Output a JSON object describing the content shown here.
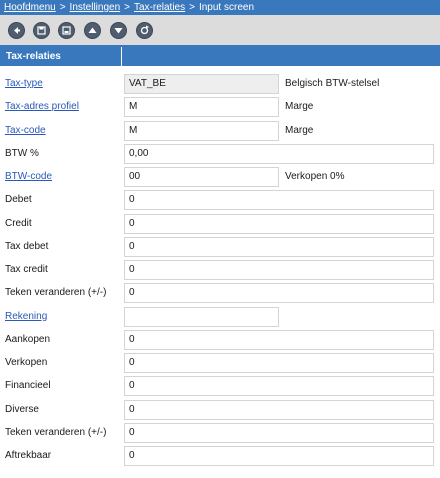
{
  "breadcrumb": {
    "items": [
      "Hoofdmenu",
      "Instellingen",
      "Tax-relaties"
    ],
    "separator": ">",
    "current": "Input screen"
  },
  "toolbar": {
    "buttons": [
      {
        "name": "back-icon"
      },
      {
        "name": "save-icon"
      },
      {
        "name": "save-close-icon"
      },
      {
        "name": "arrow-up-icon"
      },
      {
        "name": "arrow-down-icon"
      },
      {
        "name": "refresh-icon"
      }
    ]
  },
  "section": {
    "title": "Tax-relaties"
  },
  "fields": {
    "tax_type": {
      "label": "Tax-type",
      "value": "VAT_BE",
      "description": "Belgisch BTW-stelsel"
    },
    "tax_adres": {
      "label": "Tax-adres profiel",
      "value": "M",
      "description": "Marge"
    },
    "tax_code": {
      "label": "Tax-code",
      "value": "M",
      "description": "Marge"
    },
    "btw_pct": {
      "label": "BTW %",
      "value": "0,00"
    },
    "btw_code": {
      "label": "BTW-code",
      "value": "00",
      "description": "Verkopen 0%"
    },
    "debet": {
      "label": "Debet",
      "value": "0"
    },
    "credit": {
      "label": "Credit",
      "value": "0"
    },
    "tax_debet": {
      "label": "Tax debet",
      "value": "0"
    },
    "tax_credit": {
      "label": "Tax credit",
      "value": "0"
    },
    "teken1": {
      "label": "Teken veranderen (+/-)",
      "value": "0"
    },
    "rekening": {
      "label": "Rekening",
      "value": ""
    },
    "aankopen": {
      "label": "Aankopen",
      "value": "0"
    },
    "verkopen": {
      "label": "Verkopen",
      "value": "0"
    },
    "financieel": {
      "label": "Financieel",
      "value": "0"
    },
    "diverse": {
      "label": "Diverse",
      "value": "0"
    },
    "teken2": {
      "label": "Teken veranderen (+/-)",
      "value": "0"
    },
    "aftrekbaar": {
      "label": "Aftrekbaar",
      "value": "0"
    }
  },
  "colors": {
    "accent": "#3a78be",
    "toolbar_bg": "#dcdcdc",
    "link": "#2a58b8",
    "readonly_bg": "#eeeeee"
  }
}
